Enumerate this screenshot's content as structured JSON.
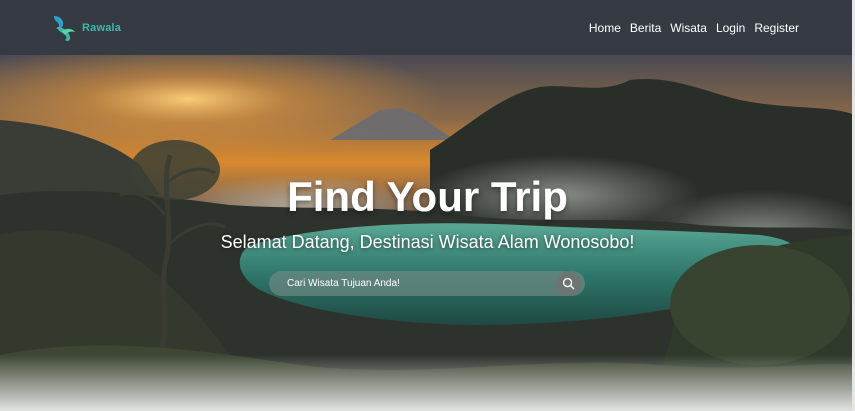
{
  "navbar": {
    "brand_name": "Rawala",
    "brand_icon": "bird-logo-icon",
    "links": [
      "Home",
      "Berita",
      "Wisata",
      "Login",
      "Register"
    ]
  },
  "hero": {
    "title": "Find Your Trip",
    "subtitle": "Selamat Datang, Destinasi Wisata Alam Wonosobo!"
  },
  "search": {
    "placeholder": "Cari Wisata Tujuan Anda!",
    "value": "",
    "button_icon": "search-icon"
  },
  "colors": {
    "navbar_bg": "#353a43",
    "brand_accent": "#3ab7ae",
    "text_light": "#ffffff"
  }
}
